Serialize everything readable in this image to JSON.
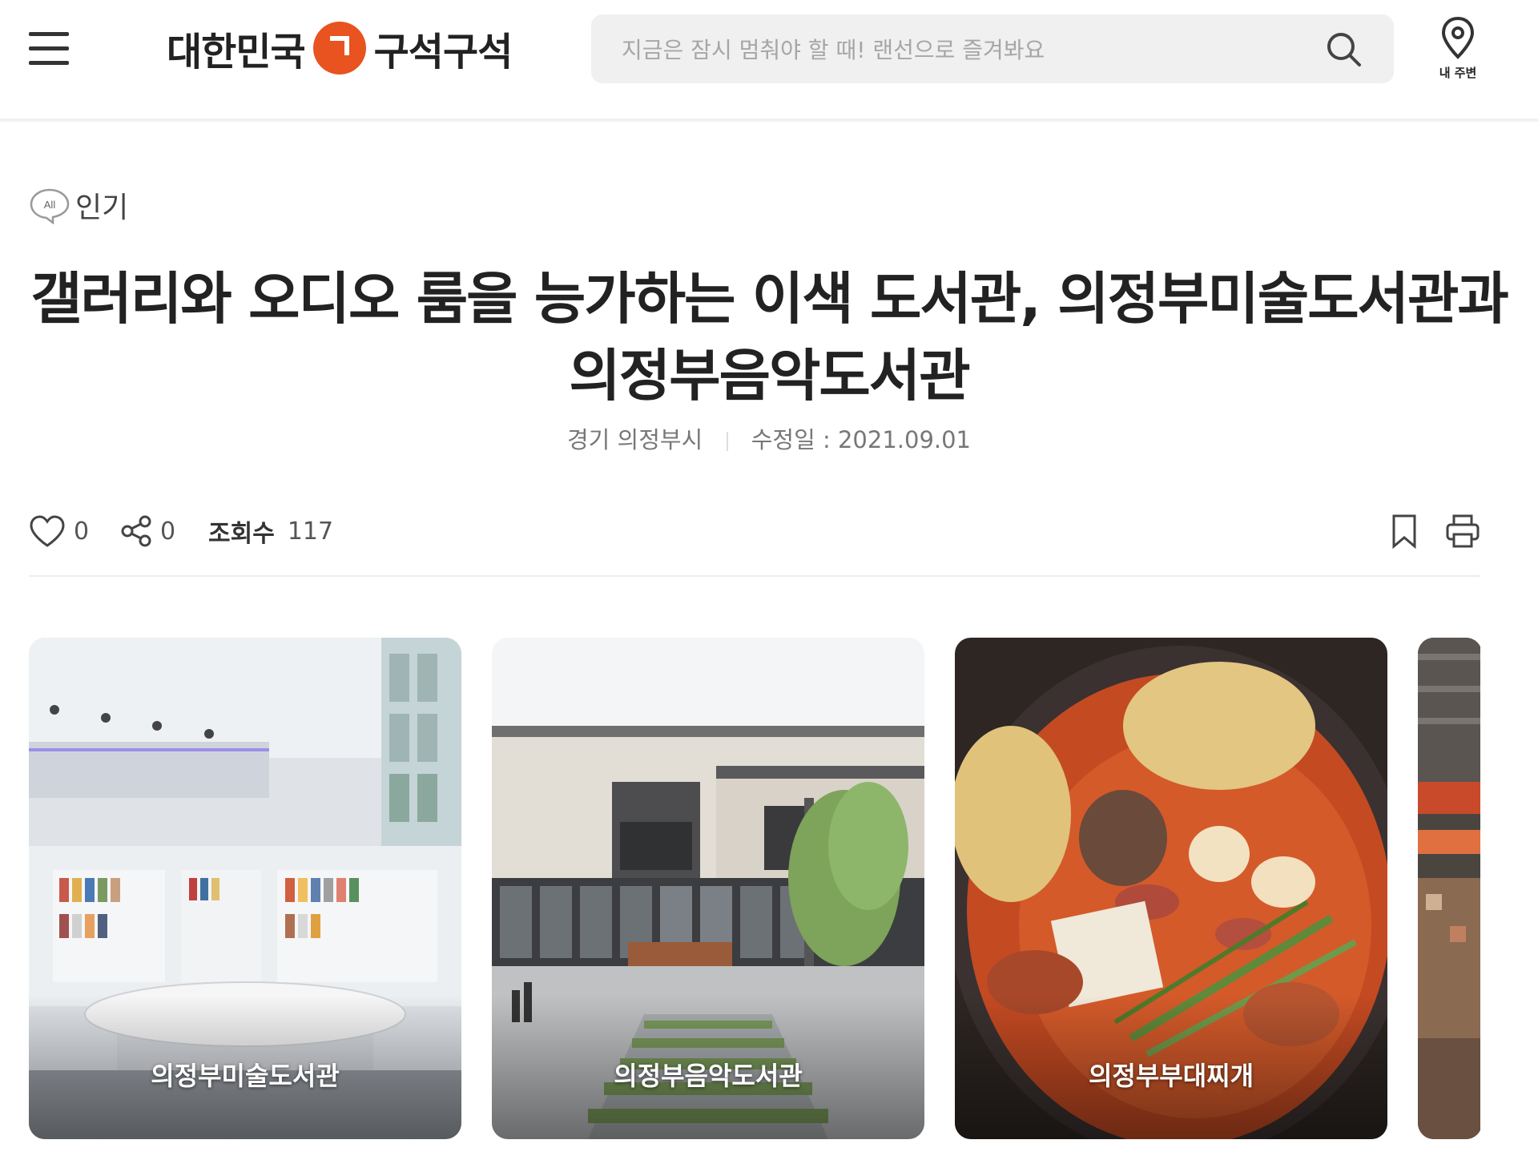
{
  "header": {
    "logo_left": "대한민국",
    "logo_right": "구석구석",
    "search": {
      "placeholder": "지금은 잠시 멈춰야 할 때! 랜선으로 즐겨봐요",
      "value": ""
    },
    "nearby_label": "내 주변",
    "menu_icon": "hamburger-icon",
    "search_icon": "search-icon",
    "nearby_icon": "location-pin-icon",
    "brand_color": "#e8531f"
  },
  "category": {
    "badge": "All",
    "label": "인기"
  },
  "article": {
    "title": "갤러리와 오디오 룸을 능가하는 이색 도서관, 의정부미술도서관과 의정부음악도서관",
    "region": "경기 의정부시",
    "modified": "수정일 : 2021.09.01"
  },
  "toolbar": {
    "likes": "0",
    "shares": "0",
    "views_label": "조회수",
    "views": "117",
    "like_icon": "heart-icon",
    "share_icon": "share-icon",
    "bookmark_icon": "bookmark-icon",
    "print_icon": "print-icon"
  },
  "cards": [
    {
      "caption": "의정부미술도서관"
    },
    {
      "caption": "의정부음악도서관"
    },
    {
      "caption": "의정부부대찌개"
    },
    {
      "caption": ""
    }
  ]
}
